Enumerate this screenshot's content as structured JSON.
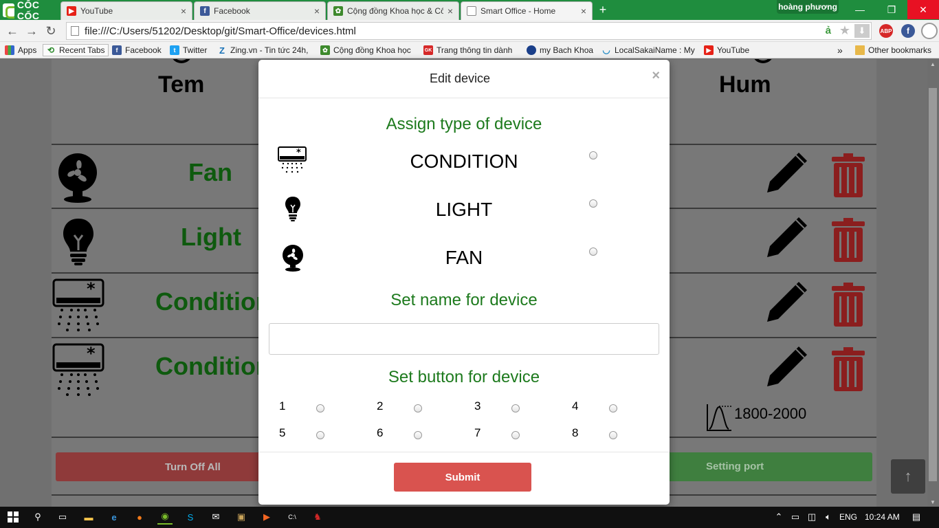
{
  "browser": {
    "brand": "CỐC CỐC",
    "profile_name": "hoàng phương",
    "tabs": [
      {
        "label": "YouTube",
        "icon": "youtube-icon",
        "color": "#e62117"
      },
      {
        "label": "Facebook",
        "icon": "facebook-icon",
        "color": "#3b5998"
      },
      {
        "label": "Cộng đồng Khoa học & Cô",
        "icon": "leaf-icon",
        "color": "#3d8a2c"
      },
      {
        "label": "Smart Office - Home",
        "icon": "page-icon",
        "color": "#888888"
      }
    ],
    "url": "file:///C:/Users/51202/Desktop/git/Smart-Office/devices.html",
    "bookmarks": [
      {
        "label": "Apps"
      },
      {
        "label": "Recent Tabs"
      },
      {
        "label": "Facebook"
      },
      {
        "label": "Twitter"
      },
      {
        "label": "Zing.vn - Tin tức 24h,"
      },
      {
        "label": "Cộng đồng Khoa học"
      },
      {
        "label": "Trang thông tin dành"
      },
      {
        "label": "my Bach Khoa"
      },
      {
        "label": "LocalSakaiName : My"
      },
      {
        "label": "YouTube"
      },
      {
        "label": "»"
      },
      {
        "label": "Other bookmarks"
      }
    ],
    "ext_abp": "ABP"
  },
  "page": {
    "headers": {
      "left": "Tem",
      "right": "Hum"
    },
    "devices": [
      {
        "name": "Fan",
        "icon": "fan-icon"
      },
      {
        "name": "Light",
        "icon": "bulb-icon"
      },
      {
        "name": "Condition",
        "icon": "air-conditioner-icon"
      },
      {
        "name": "Condition",
        "icon": "air-conditioner-icon"
      }
    ],
    "graph_value": "1800-2000",
    "turn_off_all": "Turn Off All",
    "setting_port": "Setting port",
    "scroll_top_glyph": "↑"
  },
  "modal": {
    "title": "Edit device",
    "close": "×",
    "assign_title": "Assign type of device",
    "types": [
      {
        "label": "CONDITION",
        "icon": "air-conditioner-icon"
      },
      {
        "label": "LIGHT",
        "icon": "bulb-icon"
      },
      {
        "label": "FAN",
        "icon": "fan-icon"
      }
    ],
    "name_title": "Set name for device",
    "name_value": "",
    "button_title": "Set button for device",
    "buttons": [
      "1",
      "2",
      "3",
      "4",
      "5",
      "6",
      "7",
      "8"
    ],
    "submit": "Submit"
  },
  "taskbar": {
    "lang": "ENG",
    "time": "10:24 AM"
  },
  "colors": {
    "accent_green": "#1d7a1d",
    "device_green": "#0e5a0e",
    "submit_red": "#d9534f",
    "trash_red": "#8b1e1e"
  }
}
